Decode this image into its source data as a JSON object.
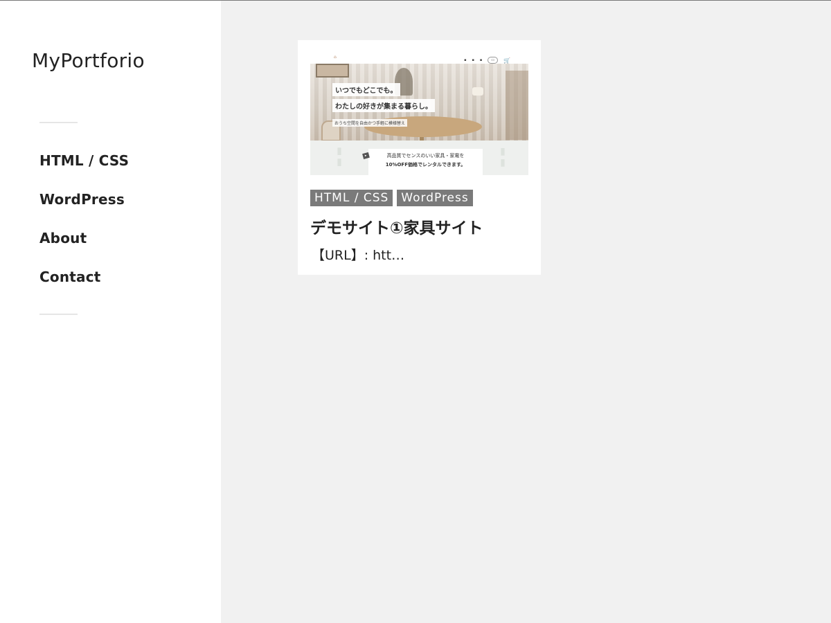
{
  "site": {
    "title": "MyPortforio"
  },
  "nav": {
    "items": [
      {
        "label": "HTML / CSS"
      },
      {
        "label": "WordPress"
      },
      {
        "label": "About"
      },
      {
        "label": "Contact"
      }
    ]
  },
  "post": {
    "tags": [
      "HTML / CSS",
      "WordPress"
    ],
    "title": "デモサイト①家具サイト",
    "excerpt": "【URL】: htt…",
    "thumbnail": {
      "hero_line1": "いつでもどこでも。",
      "hero_line2": "わたしの好きが集まる暮らし。",
      "hero_sub": "おうち空間を自由かつ手軽に模様替え",
      "banner_line1": "高品質でセンスのいい家具・家電を",
      "banner_line2": "10%OFF価格でレンタルできます。"
    }
  }
}
